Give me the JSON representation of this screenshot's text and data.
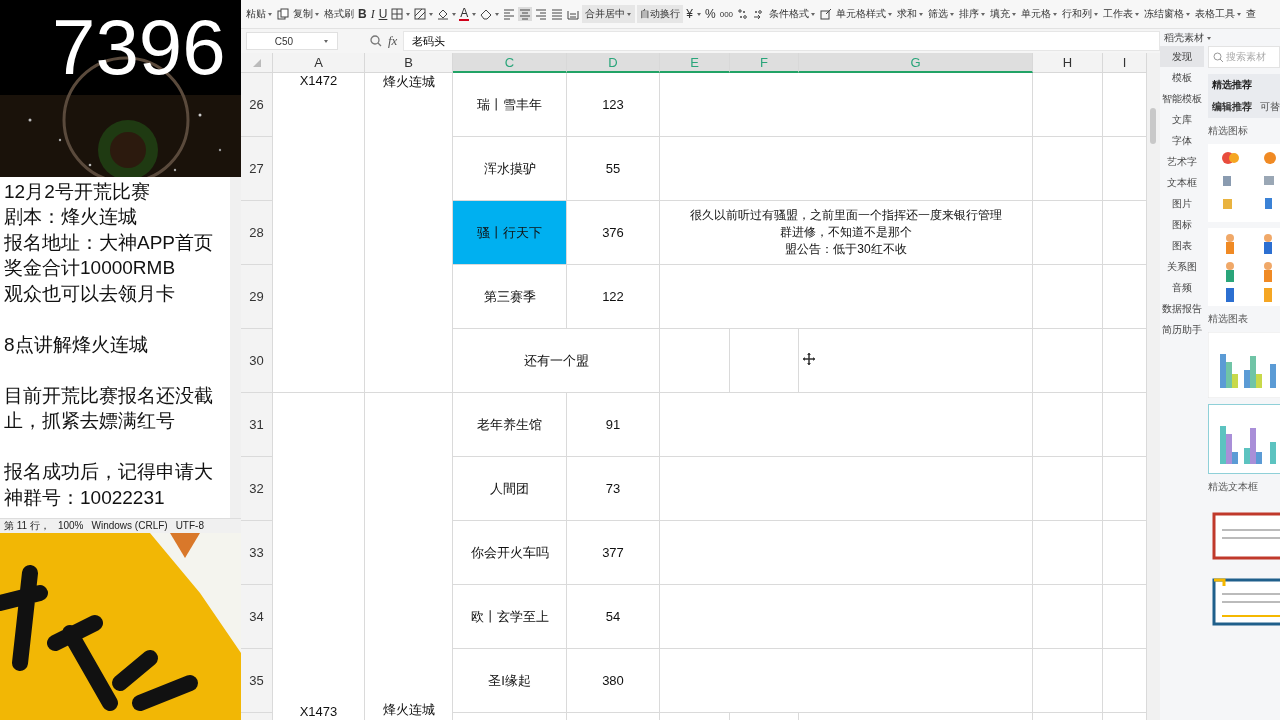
{
  "stream_overlay": {
    "counter": "7396"
  },
  "notepad": {
    "paragraphs": [
      [
        "12月2号开荒比赛",
        "剧本：烽火连城",
        "报名地址：大神APP首页",
        "奖金合计10000RMB",
        "观众也可以去领月卡"
      ],
      [
        "8点讲解烽火连城"
      ],
      [
        "目前开荒比赛报名还没截止，抓紧去嫖满红号"
      ],
      [
        "报名成功后，记得申请大神群号：10022231"
      ]
    ],
    "status_bar": [
      "第 11 行，",
      "100%",
      "Windows (CRLF)",
      "UTF-8"
    ]
  },
  "toolbar": {
    "items": [
      {
        "kind": "text",
        "label": "粘贴",
        "dropdown": true
      },
      {
        "kind": "icon",
        "selected": false,
        "dropdown": false
      },
      {
        "kind": "text",
        "label": "复制",
        "dropdown": true
      },
      {
        "kind": "text",
        "label": "格式刷",
        "dropdown": false
      },
      {
        "kind": "bold",
        "label": "B",
        "dropdown": false
      },
      {
        "kind": "italic",
        "label": "I",
        "dropdown": false
      },
      {
        "kind": "underline",
        "label": "U",
        "dropdown": false
      },
      {
        "kind": "icon",
        "selected": false,
        "dropdown": true
      },
      {
        "kind": "icon",
        "selected": false,
        "dropdown": true
      },
      {
        "kind": "icon",
        "selected": false,
        "dropdown": true
      },
      {
        "kind": "font-color",
        "label": "A",
        "dropdown": true
      },
      {
        "kind": "icon",
        "selected": false,
        "dropdown": true
      },
      {
        "kind": "icon",
        "selected": false,
        "dropdown": false
      },
      {
        "kind": "icon",
        "selected": true,
        "dropdown": false
      },
      {
        "kind": "icon",
        "selected": false,
        "dropdown": false
      },
      {
        "kind": "icon",
        "selected": false,
        "dropdown": false
      },
      {
        "kind": "icon",
        "selected": false,
        "dropdown": false
      },
      {
        "kind": "boxed",
        "label": "合并居中",
        "dropdown": true
      },
      {
        "kind": "boxed",
        "label": "自动换行",
        "dropdown": false
      },
      {
        "kind": "glyph",
        "label": "¥",
        "dropdown": true
      },
      {
        "kind": "glyph",
        "label": "%",
        "dropdown": false
      },
      {
        "kind": "small-glyph",
        "label": "000",
        "dropdown": false
      },
      {
        "kind": "icon",
        "selected": false,
        "dropdown": false
      },
      {
        "kind": "icon",
        "selected": false,
        "dropdown": false
      },
      {
        "kind": "text",
        "label": "条件格式",
        "dropdown": true
      },
      {
        "kind": "icon",
        "selected": false,
        "dropdown": false
      },
      {
        "kind": "text",
        "label": "单元格样式",
        "dropdown": true
      },
      {
        "kind": "text",
        "label": "求和",
        "dropdown": true
      },
      {
        "kind": "text",
        "label": "筛选",
        "dropdown": true
      },
      {
        "kind": "text",
        "label": "排序",
        "dropdown": true
      },
      {
        "kind": "text",
        "label": "填充",
        "dropdown": true
      },
      {
        "kind": "text",
        "label": "单元格",
        "dropdown": true
      },
      {
        "kind": "text",
        "label": "行和列",
        "dropdown": true
      },
      {
        "kind": "text",
        "label": "工作表",
        "dropdown": true
      },
      {
        "kind": "text",
        "label": "冻结窗格",
        "dropdown": true
      },
      {
        "kind": "text",
        "label": "表格工具",
        "dropdown": true
      },
      {
        "kind": "text",
        "label": "查",
        "dropdown": false
      }
    ]
  },
  "formula_bar": {
    "cell_ref": "C50",
    "function_label": "fx",
    "formula": "老码头"
  },
  "sheet": {
    "columns": [
      {
        "label": "A",
        "selected": false
      },
      {
        "label": "B",
        "selected": false
      },
      {
        "label": "C",
        "selected": true
      },
      {
        "label": "D",
        "selected": true
      },
      {
        "label": "E",
        "selected": true
      },
      {
        "label": "F",
        "selected": true
      },
      {
        "label": "G",
        "selected": true
      },
      {
        "label": "H",
        "selected": false
      },
      {
        "label": "I",
        "selected": false
      }
    ],
    "groups": [
      {
        "column_a": "X1472",
        "column_b": "烽火连城",
        "rows": [
          {
            "number": "26",
            "kind": "normal",
            "column_c": "瑞丨雪丰年",
            "column_d": "123",
            "highlighted": false
          },
          {
            "number": "27",
            "kind": "normal",
            "column_c": "浑水摸驴",
            "column_d": "55",
            "highlighted": false
          },
          {
            "number": "28",
            "kind": "normal",
            "column_c": "骚丨行天下",
            "column_d": "376",
            "highlighted": true,
            "note_lines": [
              "很久以前听过有骚盟，之前里面一个指挥还一度来银行管理",
              "群进修，不知道不是那个",
              "盟公告：低于30红不收"
            ]
          },
          {
            "number": "29",
            "kind": "normal",
            "column_c": "第三赛季",
            "column_d": "122",
            "highlighted": false
          },
          {
            "number": "30",
            "kind": "merged",
            "column_c": "还有一个盟",
            "highlighted": false
          }
        ]
      },
      {
        "column_a": "X1473",
        "column_b": "烽火连城",
        "rows": [
          {
            "number": "31",
            "kind": "normal",
            "column_c": "老年养生馆",
            "column_d": "91",
            "highlighted": false
          },
          {
            "number": "32",
            "kind": "normal",
            "column_c": "人間团",
            "column_d": "73",
            "highlighted": false
          },
          {
            "number": "33",
            "kind": "normal",
            "column_c": "你会开火车吗",
            "column_d": "377",
            "highlighted": false
          },
          {
            "number": "34",
            "kind": "normal",
            "column_c": "欧丨玄学至上",
            "column_d": "54",
            "highlighted": false
          },
          {
            "number": "35",
            "kind": "normal",
            "column_c": "圣I缘起",
            "column_d": "380",
            "highlighted": false
          }
        ]
      }
    ]
  },
  "side_panel": {
    "title": "稻壳素材",
    "nav": [
      {
        "label": "发现",
        "selected": true
      },
      {
        "label": "模板",
        "selected": false
      },
      {
        "label": "智能模板",
        "selected": false
      },
      {
        "label": "文库",
        "selected": false
      },
      {
        "label": "字体",
        "selected": false
      },
      {
        "label": "艺术字",
        "selected": false
      },
      {
        "label": "文本框",
        "selected": false
      },
      {
        "label": "图片",
        "selected": false
      },
      {
        "label": "图标",
        "selected": false
      },
      {
        "label": "图表",
        "selected": false
      },
      {
        "label": "关系图",
        "selected": false
      },
      {
        "label": "音频",
        "selected": false
      },
      {
        "label": "数据报告",
        "selected": false
      },
      {
        "label": "简历助手",
        "selected": false
      }
    ],
    "search": {
      "placeholder": "搜索素材"
    },
    "featured": {
      "title": "精选推荐",
      "tabs": [
        {
          "label": "编辑推荐",
          "selected": true
        },
        {
          "label": "可替",
          "selected": false
        }
      ]
    },
    "sections": [
      {
        "kind": "icons",
        "title": "精选图标"
      },
      {
        "kind": "charts",
        "title": "精选图表"
      },
      {
        "kind": "textboxes",
        "title": "精选文本框"
      }
    ]
  }
}
